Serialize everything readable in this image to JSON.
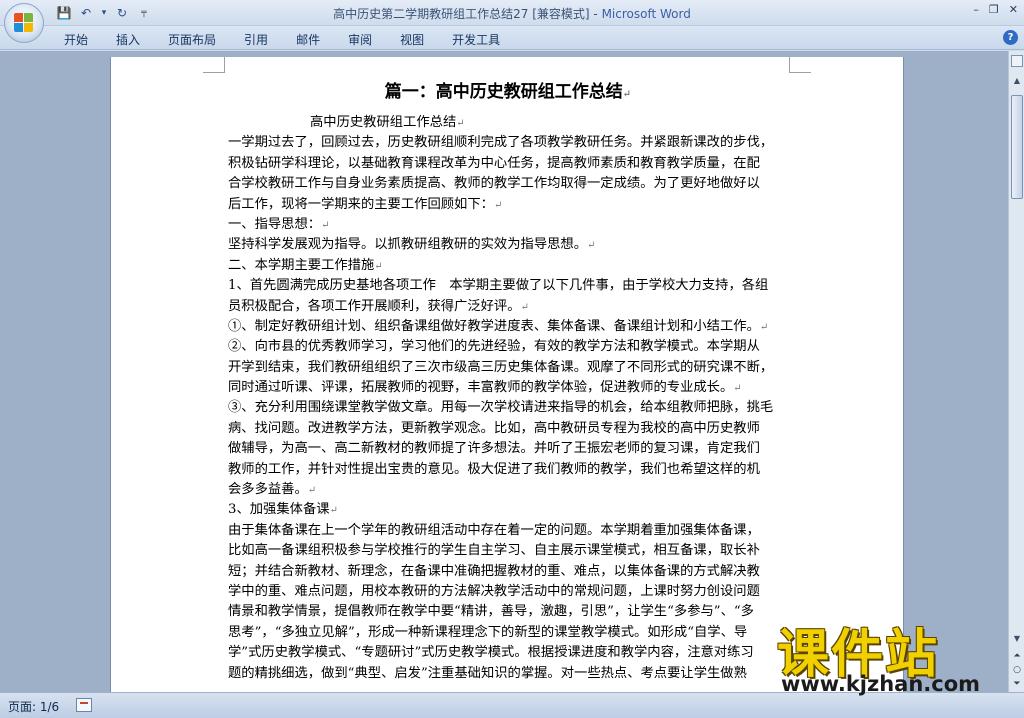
{
  "window": {
    "title": "高中历史第二学期教研组工作总结27 [兼容模式]",
    "separator": " - ",
    "app_name": "Microsoft Word",
    "controls": [
      "–",
      "❐",
      "✕"
    ]
  },
  "quick_access": {
    "icons": [
      "save-icon",
      "undo-icon",
      "dropdown-icon",
      "redo-icon",
      "customize-icon"
    ],
    "glyphs": [
      "💾",
      "↶",
      "▾",
      "↻",
      "╤"
    ]
  },
  "ribbon": {
    "tabs": [
      "开始",
      "插入",
      "页面布局",
      "引用",
      "邮件",
      "审阅",
      "视图",
      "开发工具"
    ],
    "help_glyph": "?"
  },
  "document": {
    "heading": "篇一：高中历史教研组工作总结",
    "para_mark": "↵",
    "lines": [
      {
        "text": "高中历史教研组工作总结",
        "indent": true
      },
      {
        "text": "一学期过去了，回顾过去，历史教研组顺利完成了各项教学教研任务。并紧跟新课改的步伐，",
        "indent": false
      },
      {
        "text": "积极钻研学科理论，以基础教育课程改革为中心任务，提高教师素质和教育教学质量，在配",
        "indent": false
      },
      {
        "text": "合学校教研工作与自身业务素质提高、教师的教学工作均取得一定成绩。为了更好地做好以",
        "indent": false
      },
      {
        "text": "后工作，现将一学期来的主要工作回顾如下：",
        "indent": false
      },
      {
        "text": "一、指导思想：",
        "indent": false
      },
      {
        "text": "坚持科学发展观为指导。以抓教研组教研的实效为指导思想。",
        "indent": false
      },
      {
        "text": "二、本学期主要工作措施",
        "indent": false
      },
      {
        "text": "1、首先圆满完成历史基地各项工作　本学期主要做了以下几件事，由于学校大力支持，各组",
        "indent": false
      },
      {
        "text": "员积极配合，各项工作开展顺利，获得广泛好评。",
        "indent": false
      },
      {
        "text": "①、制定好教研组计划、组织备课组做好教学进度表、集体备课、备课组计划和小结工作。",
        "indent": false
      },
      {
        "text": "②、向市县的优秀教师学习，学习他们的先进经验，有效的教学方法和教学模式。本学期从",
        "indent": false
      },
      {
        "text": "开学到结束，我们教研组组织了三次市级高三历史集体备课。观摩了不同形式的研究课不断，",
        "indent": false
      },
      {
        "text": "同时通过听课、评课，拓展教师的视野，丰富教师的教学体验，促进教师的专业成长。",
        "indent": false
      },
      {
        "text": "③、充分利用围绕课堂教学做文章。用每一次学校请进来指导的机会，给本组教师把脉，挑毛",
        "indent": false
      },
      {
        "text": "病、找问题。改进教学方法，更新教学观念。比如，高中教研员专程为我校的高中历史教师",
        "indent": false
      },
      {
        "text": "做辅导，为高一、高二新教材的教师提了许多想法。并听了王振宏老师的复习课，肯定我们",
        "indent": false
      },
      {
        "text": "教师的工作，并针对性提出宝贵的意见。极大促进了我们教师的教学，我们也希望这样的机",
        "indent": false
      },
      {
        "text": "会多多益善。",
        "indent": false
      },
      {
        "text": "3、加强集体备课",
        "indent": false
      },
      {
        "text": "由于集体备课在上一个学年的教研组活动中存在着一定的问题。本学期着重加强集体备课，",
        "indent": false
      },
      {
        "text": "比如高一备课组积极参与学校推行的学生自主学习、自主展示课堂模式，相互备课，取长补",
        "indent": false
      },
      {
        "text": "短；并结合新教材、新理念，在备课中准确把握教材的重、难点，以集体备课的方式解决教",
        "indent": false
      },
      {
        "text": "学中的重、难点问题，用校本教研的方法解决教学活动中的常规问题，上课时努力创设问题",
        "indent": false
      },
      {
        "text": "情景和教学情景，提倡教师在教学中要“精讲，善导，激趣，引思”，让学生“多参与”、“多",
        "indent": false
      },
      {
        "text": "思考”，“多独立见解”，形成一种新课程理念下的新型的课堂教学模式。如形成“自学、导",
        "indent": false
      },
      {
        "text": "学”式历史教学模式、“专题研讨”式历史教学模式。根据授课进度和教学内容，注意对练习",
        "indent": false
      },
      {
        "text": "题的精挑细选，做到“典型、启发”注重基础知识的掌握。对一些热点、考点要让学生做熟",
        "indent": false
      }
    ]
  },
  "watermark": {
    "brand": "课件站",
    "url": "www.kjzhan.com"
  },
  "scrollbar": {
    "up_glyph": "▲",
    "down_glyph": "▼",
    "prev_glyph": "⏶",
    "browse_glyph": "○",
    "next_glyph": "⏷"
  },
  "status": {
    "page_info": "页面: 1/6"
  },
  "colors": {
    "app_name": "#3b5fa6",
    "watermark": "#f1d000",
    "page_bg": "#ffffff",
    "doc_bg": "#9eb0c7"
  }
}
